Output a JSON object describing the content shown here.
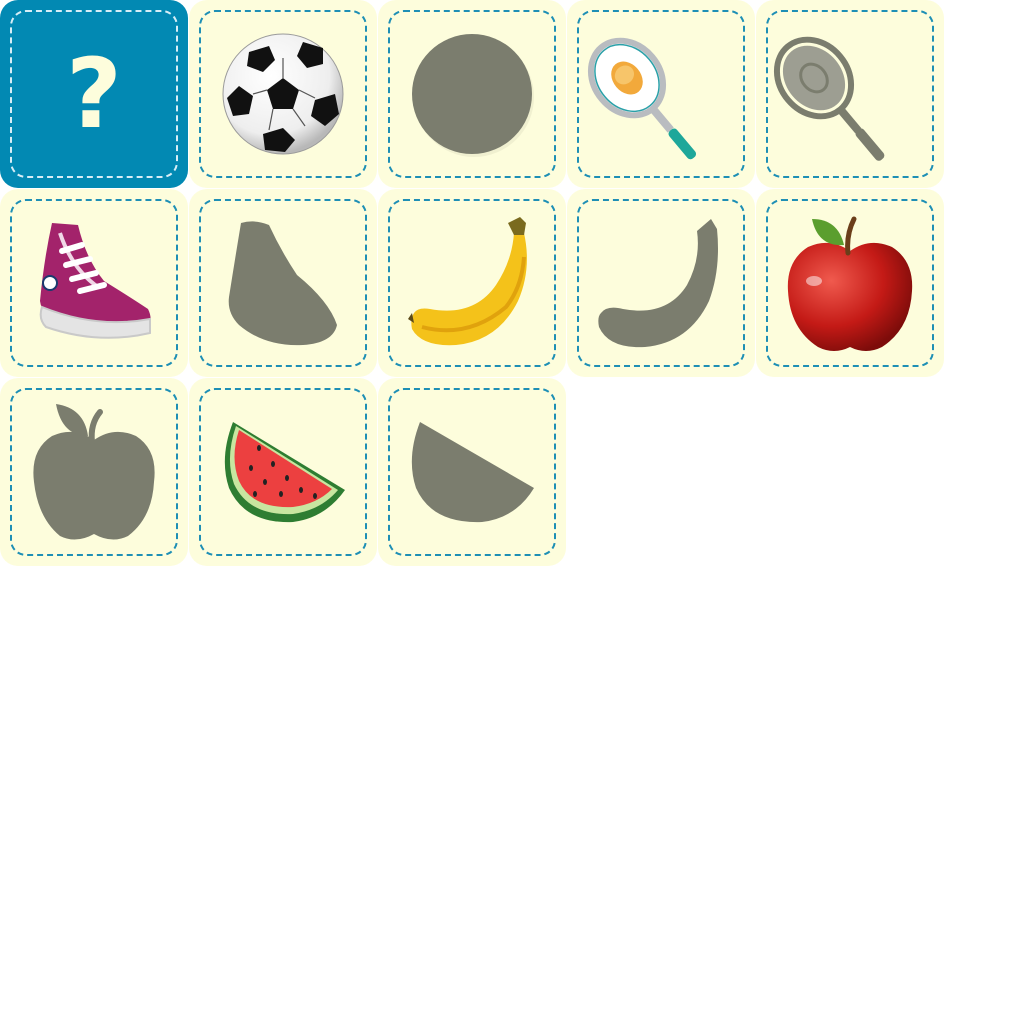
{
  "board": {
    "background": "#ffffff",
    "card_face_color": "#fdfddc",
    "card_back_color": "#0289b3",
    "border_color": "#1e8fb5",
    "shadow_color": "#7b7d6e",
    "cards": [
      {
        "kind": "back",
        "icon": "question-mark",
        "label": "?"
      },
      {
        "kind": "picture",
        "icon": "soccer-ball"
      },
      {
        "kind": "shadow",
        "icon": "soccer-ball-silhouette"
      },
      {
        "kind": "picture",
        "icon": "tennis-racket"
      },
      {
        "kind": "shadow",
        "icon": "tennis-racket-silhouette"
      },
      {
        "kind": "picture",
        "icon": "sneaker"
      },
      {
        "kind": "shadow",
        "icon": "sneaker-silhouette"
      },
      {
        "kind": "picture",
        "icon": "banana"
      },
      {
        "kind": "shadow",
        "icon": "banana-silhouette"
      },
      {
        "kind": "picture",
        "icon": "apple"
      },
      {
        "kind": "shadow",
        "icon": "apple-silhouette"
      },
      {
        "kind": "picture",
        "icon": "watermelon-slice"
      },
      {
        "kind": "shadow",
        "icon": "watermelon-silhouette"
      }
    ]
  }
}
